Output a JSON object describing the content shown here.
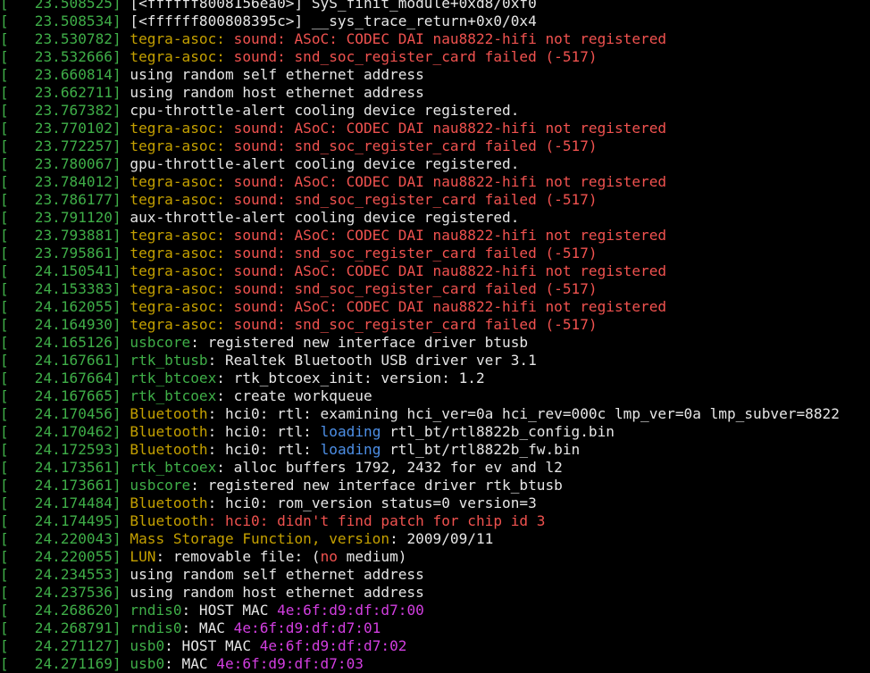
{
  "colors": {
    "background": "#000000",
    "default": "#e6e6e6",
    "timestamp": "#3fae48",
    "red": "#f0524f",
    "yellow": "#c4a000",
    "green": "#3fae48",
    "blue": "#4d8fe6",
    "magenta": "#d23ee0"
  },
  "lines": [
    {
      "ts": "   23.508525",
      "segs": [
        {
          "t": "[<ffffff8008156ea0>] SyS_finit_module+0xd8/0xf0",
          "c": "default"
        }
      ]
    },
    {
      "ts": "   23.508534",
      "segs": [
        {
          "t": "[<ffffff800808395c>] __sys_trace_return+0x0/0x4",
          "c": "default"
        }
      ]
    },
    {
      "ts": "   23.530782",
      "segs": [
        {
          "t": "tegra-asoc: ",
          "c": "yellow"
        },
        {
          "t": "sound: ASoC: CODEC DAI nau8822-hifi not registered",
          "c": "red"
        }
      ]
    },
    {
      "ts": "   23.532666",
      "segs": [
        {
          "t": "tegra-asoc: ",
          "c": "yellow"
        },
        {
          "t": "sound: snd_soc_register_card failed (-517)",
          "c": "red"
        }
      ]
    },
    {
      "ts": "   23.660814",
      "segs": [
        {
          "t": "using random self ethernet address",
          "c": "default"
        }
      ]
    },
    {
      "ts": "   23.662711",
      "segs": [
        {
          "t": "using random host ethernet address",
          "c": "default"
        }
      ]
    },
    {
      "ts": "   23.767382",
      "segs": [
        {
          "t": "cpu-throttle-alert cooling device registered.",
          "c": "default"
        }
      ]
    },
    {
      "ts": "   23.770102",
      "segs": [
        {
          "t": "tegra-asoc: ",
          "c": "yellow"
        },
        {
          "t": "sound: ASoC: CODEC DAI nau8822-hifi not registered",
          "c": "red"
        }
      ]
    },
    {
      "ts": "   23.772257",
      "segs": [
        {
          "t": "tegra-asoc: ",
          "c": "yellow"
        },
        {
          "t": "sound: snd_soc_register_card failed (-517)",
          "c": "red"
        }
      ]
    },
    {
      "ts": "   23.780067",
      "segs": [
        {
          "t": "gpu-throttle-alert cooling device registered.",
          "c": "default"
        }
      ]
    },
    {
      "ts": "   23.784012",
      "segs": [
        {
          "t": "tegra-asoc: ",
          "c": "yellow"
        },
        {
          "t": "sound: ASoC: CODEC DAI nau8822-hifi not registered",
          "c": "red"
        }
      ]
    },
    {
      "ts": "   23.786177",
      "segs": [
        {
          "t": "tegra-asoc: ",
          "c": "yellow"
        },
        {
          "t": "sound: snd_soc_register_card failed (-517)",
          "c": "red"
        }
      ]
    },
    {
      "ts": "   23.791120",
      "segs": [
        {
          "t": "aux-throttle-alert cooling device registered.",
          "c": "default"
        }
      ]
    },
    {
      "ts": "   23.793881",
      "segs": [
        {
          "t": "tegra-asoc: ",
          "c": "yellow"
        },
        {
          "t": "sound: ASoC: CODEC DAI nau8822-hifi not registered",
          "c": "red"
        }
      ]
    },
    {
      "ts": "   23.795861",
      "segs": [
        {
          "t": "tegra-asoc: ",
          "c": "yellow"
        },
        {
          "t": "sound: snd_soc_register_card failed (-517)",
          "c": "red"
        }
      ]
    },
    {
      "ts": "   24.150541",
      "segs": [
        {
          "t": "tegra-asoc: ",
          "c": "yellow"
        },
        {
          "t": "sound: ASoC: CODEC DAI nau8822-hifi not registered",
          "c": "red"
        }
      ]
    },
    {
      "ts": "   24.153383",
      "segs": [
        {
          "t": "tegra-asoc: ",
          "c": "yellow"
        },
        {
          "t": "sound: snd_soc_register_card failed (-517)",
          "c": "red"
        }
      ]
    },
    {
      "ts": "   24.162055",
      "segs": [
        {
          "t": "tegra-asoc: ",
          "c": "yellow"
        },
        {
          "t": "sound: ASoC: CODEC DAI nau8822-hifi not registered",
          "c": "red"
        }
      ]
    },
    {
      "ts": "   24.164930",
      "segs": [
        {
          "t": "tegra-asoc: ",
          "c": "yellow"
        },
        {
          "t": "sound: snd_soc_register_card failed (-517)",
          "c": "red"
        }
      ]
    },
    {
      "ts": "   24.165126",
      "segs": [
        {
          "t": "usbcore",
          "c": "green"
        },
        {
          "t": ": registered new interface driver btusb",
          "c": "default"
        }
      ]
    },
    {
      "ts": "   24.167661",
      "segs": [
        {
          "t": "rtk_btusb",
          "c": "green"
        },
        {
          "t": ": Realtek Bluetooth USB driver ver 3.1",
          "c": "default"
        }
      ]
    },
    {
      "ts": "   24.167664",
      "segs": [
        {
          "t": "rtk_btcoex",
          "c": "green"
        },
        {
          "t": ": rtk_btcoex_init: version: 1.2",
          "c": "default"
        }
      ]
    },
    {
      "ts": "   24.167665",
      "segs": [
        {
          "t": "rtk_btcoex",
          "c": "green"
        },
        {
          "t": ": create workqueue",
          "c": "default"
        }
      ]
    },
    {
      "ts": "   24.170456",
      "segs": [
        {
          "t": "Bluetooth",
          "c": "yellow"
        },
        {
          "t": ": hci0: rtl: examining hci_ver=0a hci_rev=000c lmp_ver=0a lmp_subver=8822",
          "c": "default"
        }
      ]
    },
    {
      "ts": "   24.170462",
      "segs": [
        {
          "t": "Bluetooth",
          "c": "yellow"
        },
        {
          "t": ": hci0: rtl: ",
          "c": "default"
        },
        {
          "t": "loading",
          "c": "blue"
        },
        {
          "t": " rtl_bt/rtl8822b_config.bin",
          "c": "default"
        }
      ]
    },
    {
      "ts": "   24.172593",
      "segs": [
        {
          "t": "Bluetooth",
          "c": "yellow"
        },
        {
          "t": ": hci0: rtl: ",
          "c": "default"
        },
        {
          "t": "loading",
          "c": "blue"
        },
        {
          "t": " rtl_bt/rtl8822b_fw.bin",
          "c": "default"
        }
      ]
    },
    {
      "ts": "   24.173561",
      "segs": [
        {
          "t": "rtk_btcoex",
          "c": "green"
        },
        {
          "t": ": alloc buffers 1792, 2432 for ev and l2",
          "c": "default"
        }
      ]
    },
    {
      "ts": "   24.173661",
      "segs": [
        {
          "t": "usbcore",
          "c": "green"
        },
        {
          "t": ": registered new interface driver rtk_btusb",
          "c": "default"
        }
      ]
    },
    {
      "ts": "   24.174484",
      "segs": [
        {
          "t": "Bluetooth",
          "c": "yellow"
        },
        {
          "t": ": hci0: rom_version status=0 version=3",
          "c": "default"
        }
      ]
    },
    {
      "ts": "   24.174495",
      "segs": [
        {
          "t": "Bluetooth",
          "c": "yellow"
        },
        {
          "t": ": hci0: didn't find patch for chip id 3",
          "c": "red"
        }
      ]
    },
    {
      "ts": "   24.220043",
      "segs": [
        {
          "t": "Mass Storage Function, version",
          "c": "yellow"
        },
        {
          "t": ": 2009/09/11",
          "c": "default"
        }
      ]
    },
    {
      "ts": "   24.220055",
      "segs": [
        {
          "t": "LUN",
          "c": "yellow"
        },
        {
          "t": ": removable file: (",
          "c": "default"
        },
        {
          "t": "no",
          "c": "red"
        },
        {
          "t": " medium)",
          "c": "default"
        }
      ]
    },
    {
      "ts": "   24.234553",
      "segs": [
        {
          "t": "using random self ethernet address",
          "c": "default"
        }
      ]
    },
    {
      "ts": "   24.237536",
      "segs": [
        {
          "t": "using random host ethernet address",
          "c": "default"
        }
      ]
    },
    {
      "ts": "   24.268620",
      "segs": [
        {
          "t": "rndis0",
          "c": "green"
        },
        {
          "t": ": HOST MAC ",
          "c": "default"
        },
        {
          "t": "4e:6f:d9:df:d7:00",
          "c": "magenta"
        }
      ]
    },
    {
      "ts": "   24.268791",
      "segs": [
        {
          "t": "rndis0",
          "c": "green"
        },
        {
          "t": ": MAC ",
          "c": "default"
        },
        {
          "t": "4e:6f:d9:df:d7:01",
          "c": "magenta"
        }
      ]
    },
    {
      "ts": "   24.271127",
      "segs": [
        {
          "t": "usb0",
          "c": "green"
        },
        {
          "t": ": HOST MAC ",
          "c": "default"
        },
        {
          "t": "4e:6f:d9:df:d7:02",
          "c": "magenta"
        }
      ]
    },
    {
      "ts": "   24.271169",
      "segs": [
        {
          "t": "usb0",
          "c": "green"
        },
        {
          "t": ": MAC ",
          "c": "default"
        },
        {
          "t": "4e:6f:d9:df:d7:03",
          "c": "magenta"
        }
      ]
    }
  ]
}
